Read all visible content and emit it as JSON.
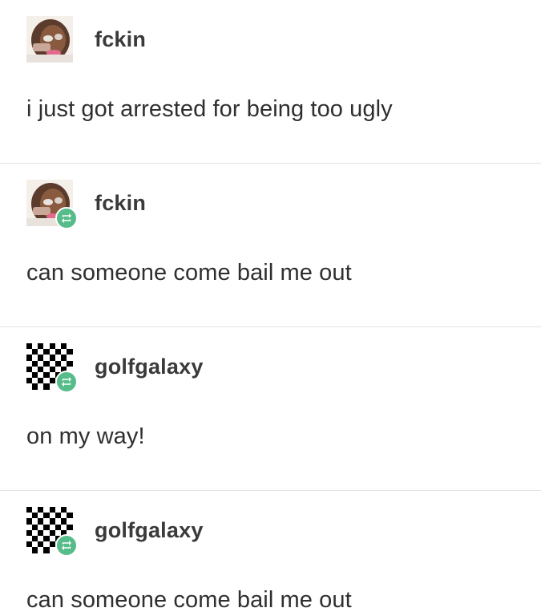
{
  "posts": [
    {
      "username": "fckin",
      "text": "i just got arrested for being too ugly",
      "avatar": "portrait-photo",
      "reblog": false
    },
    {
      "username": "fckin",
      "text": "can someone come bail me out",
      "avatar": "portrait-photo",
      "reblog": true
    },
    {
      "username": "golfgalaxy",
      "text": "on my way!",
      "avatar": "checkerboard",
      "reblog": true
    },
    {
      "username": "golfgalaxy",
      "text": "can someone come bail me out",
      "avatar": "checkerboard",
      "reblog": true
    }
  ],
  "colors": {
    "reblog_badge": "#56bc8a",
    "divider": "#e3e3e3",
    "text": "#2f2f2f"
  }
}
